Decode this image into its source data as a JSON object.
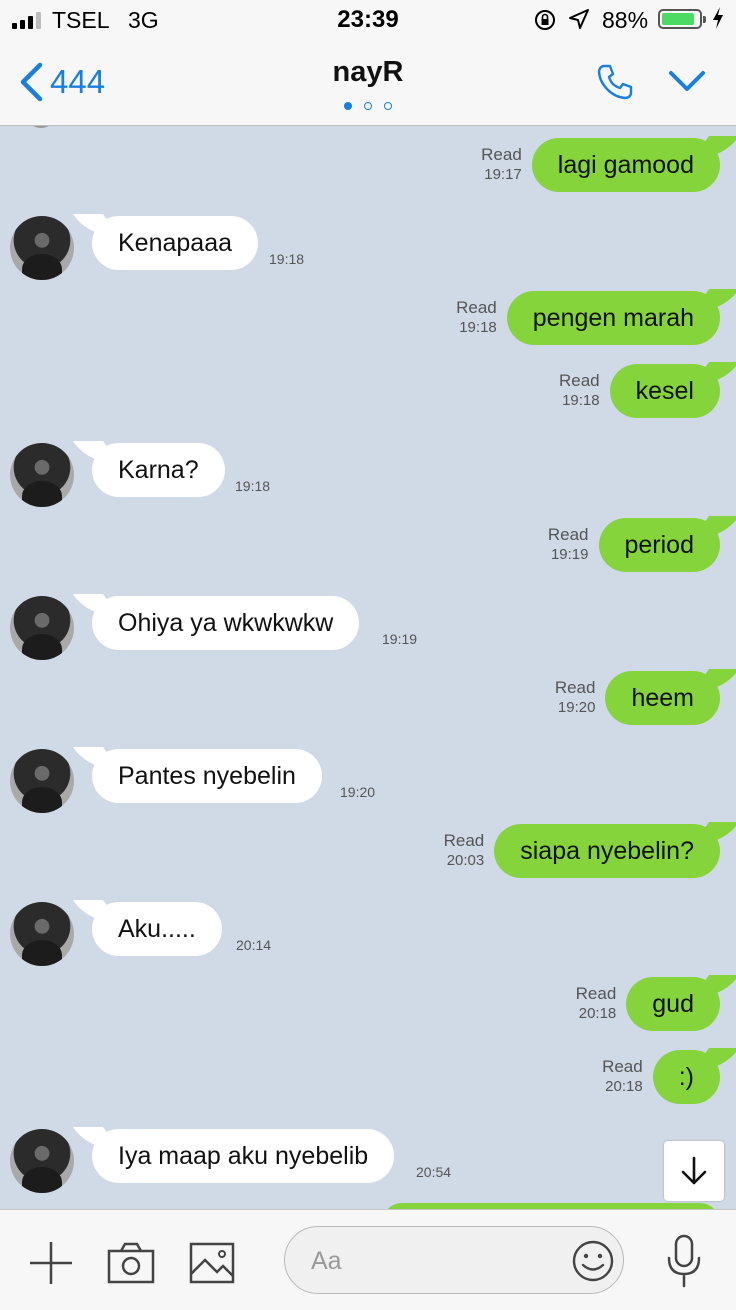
{
  "status_bar": {
    "carrier": "TSEL",
    "network": "3G",
    "time": "23:39",
    "battery_percent": "88%",
    "battery_level": 0.88,
    "signal_bars": 3
  },
  "header": {
    "back_label": "444",
    "title": "nayR",
    "page_dots": 3,
    "active_dot": 0
  },
  "messages": [
    {
      "direction": "out",
      "text": "lagi gamood",
      "status": "Read",
      "time": "19:17"
    },
    {
      "direction": "in",
      "text": "Kenapaaa",
      "time": "19:18"
    },
    {
      "direction": "out",
      "text": "pengen marah",
      "status": "Read",
      "time": "19:18"
    },
    {
      "direction": "out",
      "text": "kesel",
      "status": "Read",
      "time": "19:18"
    },
    {
      "direction": "in",
      "text": "Karna?",
      "time": "19:18"
    },
    {
      "direction": "out",
      "text": "period",
      "status": "Read",
      "time": "19:19"
    },
    {
      "direction": "in",
      "text": "Ohiya ya wkwkwkw",
      "time": "19:19"
    },
    {
      "direction": "out",
      "text": "heem",
      "status": "Read",
      "time": "19:20"
    },
    {
      "direction": "in",
      "text": "Pantes nyebelin",
      "time": "19:20"
    },
    {
      "direction": "out",
      "text": "siapa nyebelin?",
      "status": "Read",
      "time": "20:03"
    },
    {
      "direction": "in",
      "text": "Aku.....",
      "time": "20:14"
    },
    {
      "direction": "out",
      "text": "gud",
      "status": "Read",
      "time": "20:18"
    },
    {
      "direction": "out",
      "text": ":)",
      "status": "Read",
      "time": "20:18"
    },
    {
      "direction": "in",
      "text": "Iya maap aku nyebelib",
      "time": "20:54"
    }
  ],
  "input": {
    "placeholder": "Aa"
  },
  "colors": {
    "accent": "#1a7fe0",
    "outgoing_bubble": "#86d43c",
    "incoming_bubble": "#ffffff",
    "chat_background": "#cfdae6",
    "battery": "#4cd964"
  },
  "icons": [
    "back-chevron-icon",
    "phone-icon",
    "chevron-down-icon",
    "plus-icon",
    "camera-icon",
    "image-icon",
    "emoji-icon",
    "microphone-icon",
    "arrow-down-icon",
    "lock-rotation-icon",
    "location-arrow-icon",
    "charging-bolt-icon"
  ]
}
